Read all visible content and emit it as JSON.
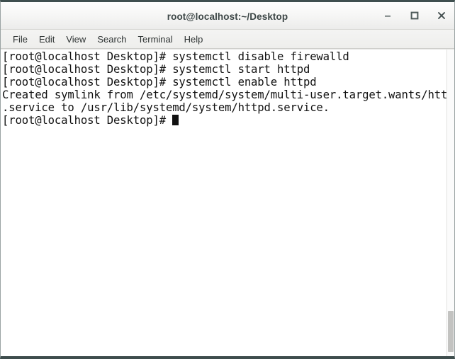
{
  "window": {
    "title": "root@localhost:~/Desktop",
    "controls": [
      {
        "name": "minimize-button",
        "label": "_",
        "icon": "minimize-icon"
      },
      {
        "name": "maximize-button",
        "label": "□",
        "icon": "maximize-icon"
      },
      {
        "name": "close-button",
        "label": "✕",
        "icon": "close-icon"
      }
    ]
  },
  "menubar": {
    "items": [
      {
        "label": "File"
      },
      {
        "label": "Edit"
      },
      {
        "label": "View"
      },
      {
        "label": "Search"
      },
      {
        "label": "Terminal"
      },
      {
        "label": "Help"
      }
    ]
  },
  "terminal": {
    "prompt": "[root@localhost Desktop]# ",
    "lines": [
      "[root@localhost Desktop]# systemctl disable firewalld",
      "[root@localhost Desktop]# systemctl start httpd",
      "[root@localhost Desktop]# systemctl enable httpd",
      "Created symlink from /etc/systemd/system/multi-user.target.wants/httpd",
      ".service to /usr/lib/systemd/system/httpd.service.",
      "[root@localhost Desktop]# "
    ],
    "cursor_line_index": 5,
    "foreground_color": "#111111",
    "background_color": "#ffffff"
  },
  "colors": {
    "titlebar_top": "#fdfdfd",
    "titlebar_bottom": "#ececeb",
    "menubar": "#eeeeec",
    "window_border": "#3f4f4f",
    "scrollbar_thumb": "#c3c3c1"
  }
}
